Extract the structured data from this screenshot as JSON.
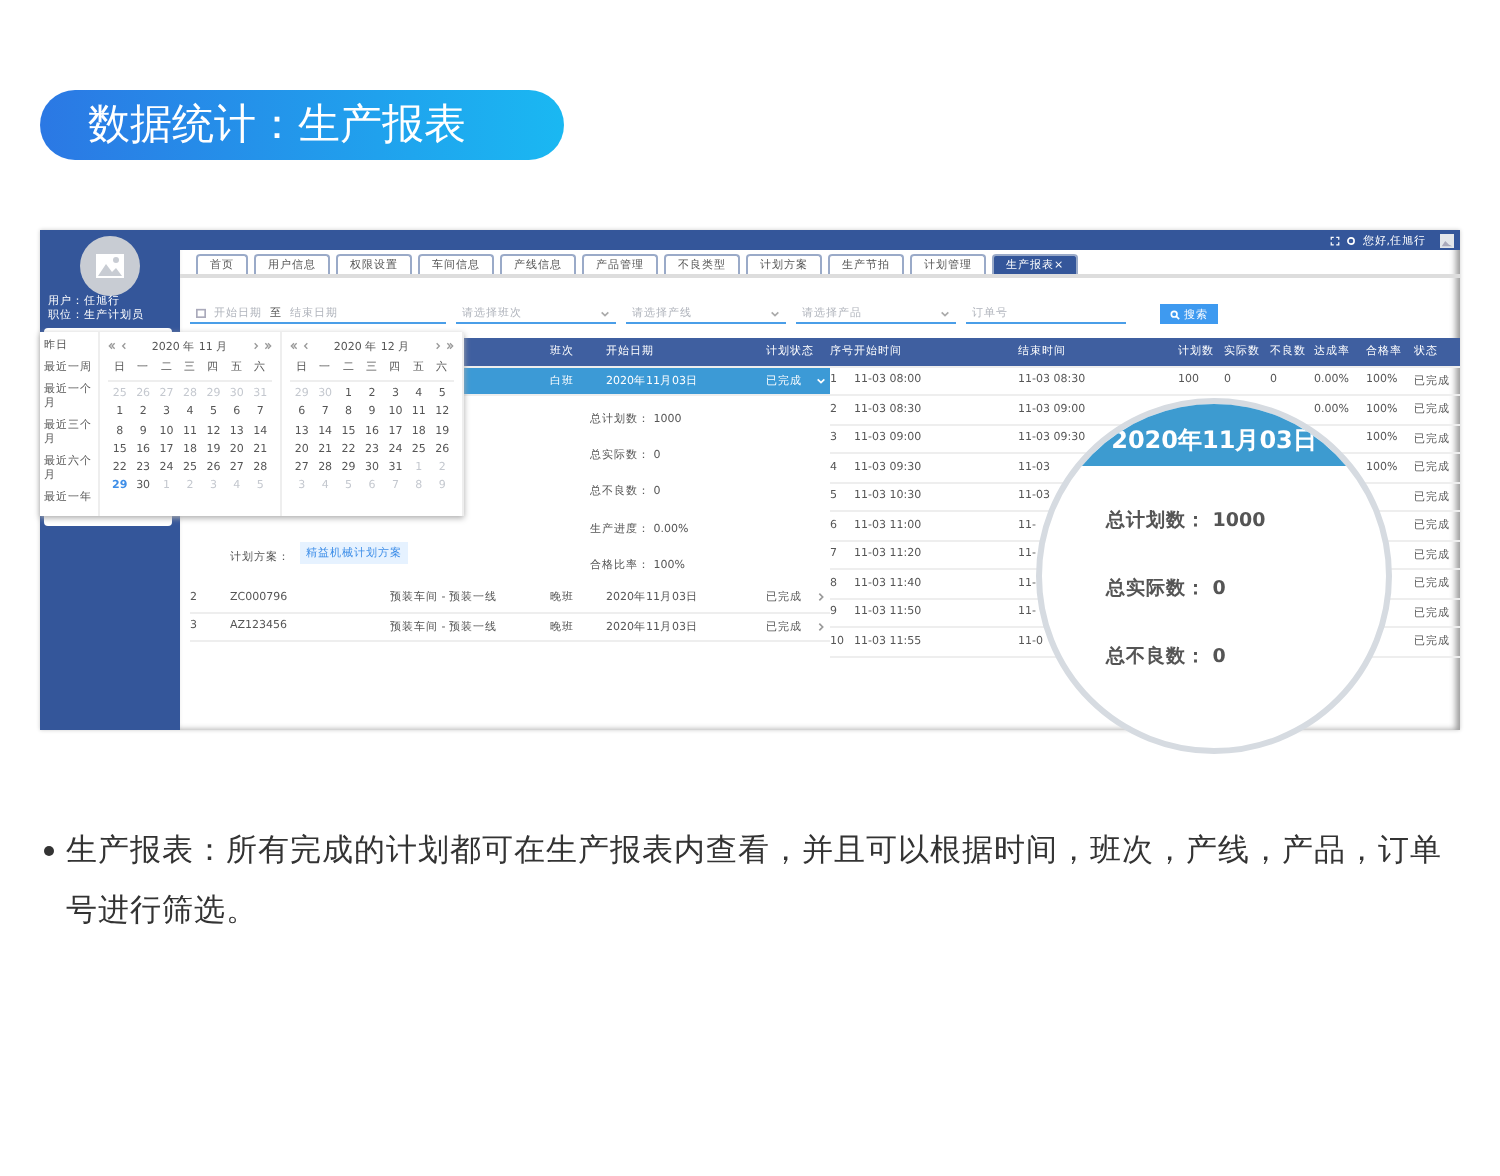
{
  "heading": "数据统计：生产报表",
  "app": {
    "user_name": "用户：任旭行",
    "user_role": "职位：生产计划员",
    "greeting": "您好,任旭行",
    "tabs": [
      {
        "label": "首页",
        "selected": false
      },
      {
        "label": "用户信息",
        "selected": false
      },
      {
        "label": "权限设置",
        "selected": false
      },
      {
        "label": "车间信息",
        "selected": false
      },
      {
        "label": "产线信息",
        "selected": false
      },
      {
        "label": "产品管理",
        "selected": false
      },
      {
        "label": "不良类型",
        "selected": false
      },
      {
        "label": "计划方案",
        "selected": false
      },
      {
        "label": "生产节拍",
        "selected": false
      },
      {
        "label": "计划管理",
        "selected": false
      },
      {
        "label": "生产报表",
        "selected": true,
        "close": "×"
      }
    ],
    "filters": {
      "start_placeholder": "开始日期",
      "range_sep": "至",
      "end_placeholder": "结束日期",
      "selects": [
        {
          "placeholder": "请选择班次"
        },
        {
          "placeholder": "请选择产线"
        },
        {
          "placeholder": "请选择产品"
        }
      ],
      "order_placeholder": "订单号",
      "search_button": "搜索"
    },
    "plans": {
      "columns": [
        "班次",
        "开始日期",
        "计划状态"
      ],
      "rows": [
        {
          "no": null,
          "order": null,
          "line": null,
          "shift": "白班",
          "date": "2020年11月03日",
          "status": "已完成",
          "expanded": true,
          "selected": true
        },
        {
          "no": "2",
          "order": "ZC000796",
          "line": "预装车间 - 预装一线",
          "shift": "晚班",
          "date": "2020年11月03日",
          "status": "已完成",
          "expanded": false,
          "selected": false
        },
        {
          "no": "3",
          "order": "AZ123456",
          "line": "预装车间 - 预装一线",
          "shift": "晚班",
          "date": "2020年11月03日",
          "status": "已完成",
          "expanded": false,
          "selected": false
        }
      ],
      "details": [
        {
          "label": "总计划数：",
          "value": "1000"
        },
        {
          "label": "总实际数：",
          "value": "0"
        },
        {
          "label": "总不良数：",
          "value": "0"
        },
        {
          "label": "生产进度：",
          "value": "0.00%"
        },
        {
          "label": "合格比率：",
          "value": "100%"
        }
      ],
      "scheme_label": "计划方案：",
      "scheme_tag": "精益机械计划方案"
    },
    "periods": {
      "columns": [
        "序号",
        "开始时间",
        "结束时间",
        "计划数",
        "实际数",
        "不良数",
        "达成率",
        "合格率",
        "状态"
      ],
      "rows": [
        {
          "no": "1",
          "start": "11-03 08:00",
          "end": "11-03 08:30",
          "plan": "100",
          "actual": "0",
          "bad": "0",
          "rate": "0.00%",
          "pass": "100%",
          "status": "已完成"
        },
        {
          "no": "2",
          "start": "11-03 08:30",
          "end": "11-03 09:00",
          "rate": "0.00%",
          "pass": "100%",
          "status": "已完成"
        },
        {
          "no": "3",
          "start": "11-03 09:00",
          "end": "11-03 09:30",
          "pass": "100%",
          "status": "已完成"
        },
        {
          "no": "4",
          "start": "11-03 09:30",
          "end": "11-03",
          "pass": "100%",
          "status": "已完成"
        },
        {
          "no": "5",
          "start": "11-03 10:30",
          "end": "11-03",
          "status": "已完成"
        },
        {
          "no": "6",
          "start": "11-03 11:00",
          "end": "11-",
          "status": "已完成"
        },
        {
          "no": "7",
          "start": "11-03 11:20",
          "end": "11-",
          "status": "已完成"
        },
        {
          "no": "8",
          "start": "11-03 11:40",
          "end": "11-",
          "status": "已完成"
        },
        {
          "no": "9",
          "start": "11-03 11:50",
          "end": "11-",
          "status": "已完成"
        },
        {
          "no": "10",
          "start": "11-03 11:55",
          "end": "11-0",
          "status": "已完成"
        }
      ]
    },
    "date_picker": {
      "shortcuts": [
        "昨日",
        "最近一周",
        "最近一个月",
        "最近三个月",
        "最近六个月",
        "最近一年"
      ],
      "months": [
        {
          "title": "2020 年 11 月",
          "weekdays": [
            "日",
            "一",
            "二",
            "三",
            "四",
            "五",
            "六"
          ],
          "weeks": [
            [
              {
                "d": "25",
                "muted": true,
                "today": false
              },
              {
                "d": "26",
                "muted": true,
                "today": false
              },
              {
                "d": "27",
                "muted": true,
                "today": false
              },
              {
                "d": "28",
                "muted": true,
                "today": false
              },
              {
                "d": "29",
                "muted": true,
                "today": false
              },
              {
                "d": "30",
                "muted": true,
                "today": false
              },
              {
                "d": "31",
                "muted": true,
                "today": false
              }
            ],
            [
              {
                "d": "1",
                "muted": false,
                "today": false
              },
              {
                "d": "2",
                "muted": false,
                "today": false
              },
              {
                "d": "3",
                "muted": false,
                "today": false
              },
              {
                "d": "4",
                "muted": false,
                "today": false
              },
              {
                "d": "5",
                "muted": false,
                "today": false
              },
              {
                "d": "6",
                "muted": false,
                "today": false
              },
              {
                "d": "7",
                "muted": false,
                "today": false
              }
            ],
            [
              {
                "d": "8",
                "muted": false,
                "today": false
              },
              {
                "d": "9",
                "muted": false,
                "today": false
              },
              {
                "d": "10",
                "muted": false,
                "today": false
              },
              {
                "d": "11",
                "muted": false,
                "today": false
              },
              {
                "d": "12",
                "muted": false,
                "today": false
              },
              {
                "d": "13",
                "muted": false,
                "today": false
              },
              {
                "d": "14",
                "muted": false,
                "today": false
              }
            ],
            [
              {
                "d": "15",
                "muted": false,
                "today": false
              },
              {
                "d": "16",
                "muted": false,
                "today": false
              },
              {
                "d": "17",
                "muted": false,
                "today": false
              },
              {
                "d": "18",
                "muted": false,
                "today": false
              },
              {
                "d": "19",
                "muted": false,
                "today": false
              },
              {
                "d": "20",
                "muted": false,
                "today": false
              },
              {
                "d": "21",
                "muted": false,
                "today": false
              }
            ],
            [
              {
                "d": "22",
                "muted": false,
                "today": false
              },
              {
                "d": "23",
                "muted": false,
                "today": false
              },
              {
                "d": "24",
                "muted": false,
                "today": false
              },
              {
                "d": "25",
                "muted": false,
                "today": false
              },
              {
                "d": "26",
                "muted": false,
                "today": false
              },
              {
                "d": "27",
                "muted": false,
                "today": false
              },
              {
                "d": "28",
                "muted": false,
                "today": false
              }
            ],
            [
              {
                "d": "29",
                "muted": false,
                "today": true
              },
              {
                "d": "30",
                "muted": false,
                "today": false
              },
              {
                "d": "1",
                "muted": true,
                "today": false
              },
              {
                "d": "2",
                "muted": true,
                "today": false
              },
              {
                "d": "3",
                "muted": true,
                "today": false
              },
              {
                "d": "4",
                "muted": true,
                "today": false
              },
              {
                "d": "5",
                "muted": true,
                "today": false
              }
            ]
          ]
        },
        {
          "title": "2020 年 12 月",
          "weekdays": [
            "日",
            "一",
            "二",
            "三",
            "四",
            "五",
            "六"
          ],
          "weeks": [
            [
              {
                "d": "29",
                "muted": true,
                "today": false
              },
              {
                "d": "30",
                "muted": true,
                "today": false
              },
              {
                "d": "1",
                "muted": false,
                "today": false
              },
              {
                "d": "2",
                "muted": false,
                "today": false
              },
              {
                "d": "3",
                "muted": false,
                "today": false
              },
              {
                "d": "4",
                "muted": false,
                "today": false
              },
              {
                "d": "5",
                "muted": false,
                "today": false
              }
            ],
            [
              {
                "d": "6",
                "muted": false,
                "today": false
              },
              {
                "d": "7",
                "muted": false,
                "today": false
              },
              {
                "d": "8",
                "muted": false,
                "today": false
              },
              {
                "d": "9",
                "muted": false,
                "today": false
              },
              {
                "d": "10",
                "muted": false,
                "today": false
              },
              {
                "d": "11",
                "muted": false,
                "today": false
              },
              {
                "d": "12",
                "muted": false,
                "today": false
              }
            ],
            [
              {
                "d": "13",
                "muted": false,
                "today": false
              },
              {
                "d": "14",
                "muted": false,
                "today": false
              },
              {
                "d": "15",
                "muted": false,
                "today": false
              },
              {
                "d": "16",
                "muted": false,
                "today": false
              },
              {
                "d": "17",
                "muted": false,
                "today": false
              },
              {
                "d": "18",
                "muted": false,
                "today": false
              },
              {
                "d": "19",
                "muted": false,
                "today": false
              }
            ],
            [
              {
                "d": "20",
                "muted": false,
                "today": false
              },
              {
                "d": "21",
                "muted": false,
                "today": false
              },
              {
                "d": "22",
                "muted": false,
                "today": false
              },
              {
                "d": "23",
                "muted": false,
                "today": false
              },
              {
                "d": "24",
                "muted": false,
                "today": false
              },
              {
                "d": "25",
                "muted": false,
                "today": false
              },
              {
                "d": "26",
                "muted": false,
                "today": false
              }
            ],
            [
              {
                "d": "27",
                "muted": false,
                "today": false
              },
              {
                "d": "28",
                "muted": false,
                "today": false
              },
              {
                "d": "29",
                "muted": false,
                "today": false
              },
              {
                "d": "30",
                "muted": false,
                "today": false
              },
              {
                "d": "31",
                "muted": false,
                "today": false
              },
              {
                "d": "1",
                "muted": true,
                "today": false
              },
              {
                "d": "2",
                "muted": true,
                "today": false
              }
            ],
            [
              {
                "d": "3",
                "muted": true,
                "today": false
              },
              {
                "d": "4",
                "muted": true,
                "today": false
              },
              {
                "d": "5",
                "muted": true,
                "today": false
              },
              {
                "d": "6",
                "muted": true,
                "today": false
              },
              {
                "d": "7",
                "muted": true,
                "today": false
              },
              {
                "d": "8",
                "muted": true,
                "today": false
              },
              {
                "d": "9",
                "muted": true,
                "today": false
              }
            ]
          ]
        }
      ]
    }
  },
  "magnifier": {
    "date": "2020年11月03日",
    "items": [
      {
        "label": "总计划数：",
        "value": "1000"
      },
      {
        "label": "总实际数：",
        "value": "0"
      },
      {
        "label": "总不良数：",
        "value": "0"
      }
    ]
  },
  "description": "生产报表：所有完成的计划都可在生产报表内查看，并且可以根据时间，班次，产线，产品，订单号进行筛选。"
}
